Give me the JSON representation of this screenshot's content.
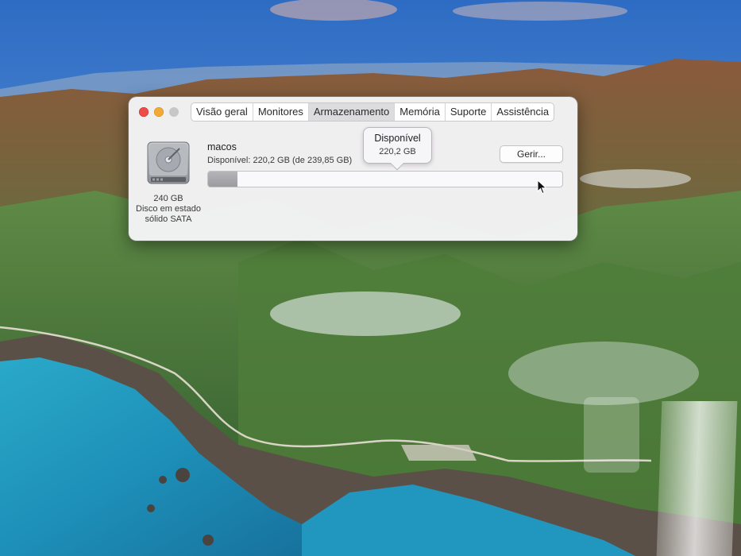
{
  "window": {
    "tabs": [
      {
        "label": "Visão geral",
        "active": false
      },
      {
        "label": "Monitores",
        "active": false
      },
      {
        "label": "Armazenamento",
        "active": true
      },
      {
        "label": "Memória",
        "active": false
      },
      {
        "label": "Suporte",
        "active": false
      },
      {
        "label": "Assistência",
        "active": false
      }
    ]
  },
  "storage": {
    "disk": {
      "icon": "hard-drive-icon",
      "capacity": "240 GB",
      "type_line1": "Disco em estado",
      "type_line2": "sólido SATA"
    },
    "volume_name": "macos",
    "available_text": "Disponível: 220,2 GB (de 239,85 GB)",
    "manage_label": "Gerir...",
    "used_fraction": 0.082,
    "tooltip": {
      "title": "Disponível",
      "value": "220,2 GB"
    }
  },
  "colors": {
    "close": "#ec4b48",
    "minimize": "#f2a935",
    "zoom": "#c7c7c9",
    "used_segment": "#a8a8ac"
  }
}
